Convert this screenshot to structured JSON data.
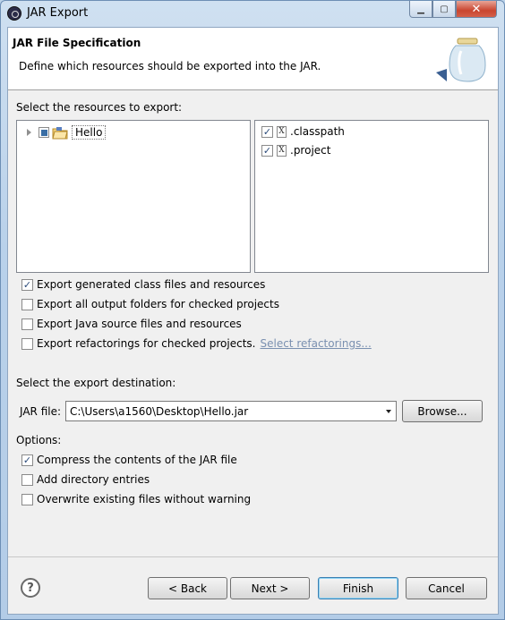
{
  "window": {
    "title": "JAR Export"
  },
  "window_buttons": {
    "minimize": "▁",
    "maximize": "▢",
    "close": "✕"
  },
  "header": {
    "title": "JAR File Specification",
    "description": "Define which resources should be exported into the JAR."
  },
  "resources": {
    "label": "Select the resources to export:",
    "tree": [
      {
        "label": "Hello",
        "state": "partial"
      }
    ],
    "files": [
      {
        "label": ".classpath",
        "checked": true,
        "icon": "X"
      },
      {
        "label": ".project",
        "checked": true,
        "icon": "X"
      }
    ]
  },
  "export_options": [
    {
      "label": "Export generated class files and resources",
      "checked": true
    },
    {
      "label": "Export all output folders for checked projects",
      "checked": false
    },
    {
      "label": "Export Java source files and resources",
      "checked": false
    },
    {
      "label": "Export refactorings for checked projects.",
      "checked": false,
      "link": "Select refactorings..."
    }
  ],
  "destination": {
    "label": "Select the export destination:",
    "jar_label": "JAR file:",
    "jar_value": "C:\\Users\\a1560\\Desktop\\Hello.jar",
    "browse": "Browse..."
  },
  "options": {
    "label": "Options:",
    "items": [
      {
        "label": "Compress the contents of the JAR file",
        "checked": true
      },
      {
        "label": "Add directory entries",
        "checked": false
      },
      {
        "label": "Overwrite existing files without warning",
        "checked": false
      }
    ]
  },
  "buttons": {
    "help": "?",
    "back": "< Back",
    "next": "Next >",
    "finish": "Finish",
    "cancel": "Cancel"
  },
  "check_mark": "✓"
}
